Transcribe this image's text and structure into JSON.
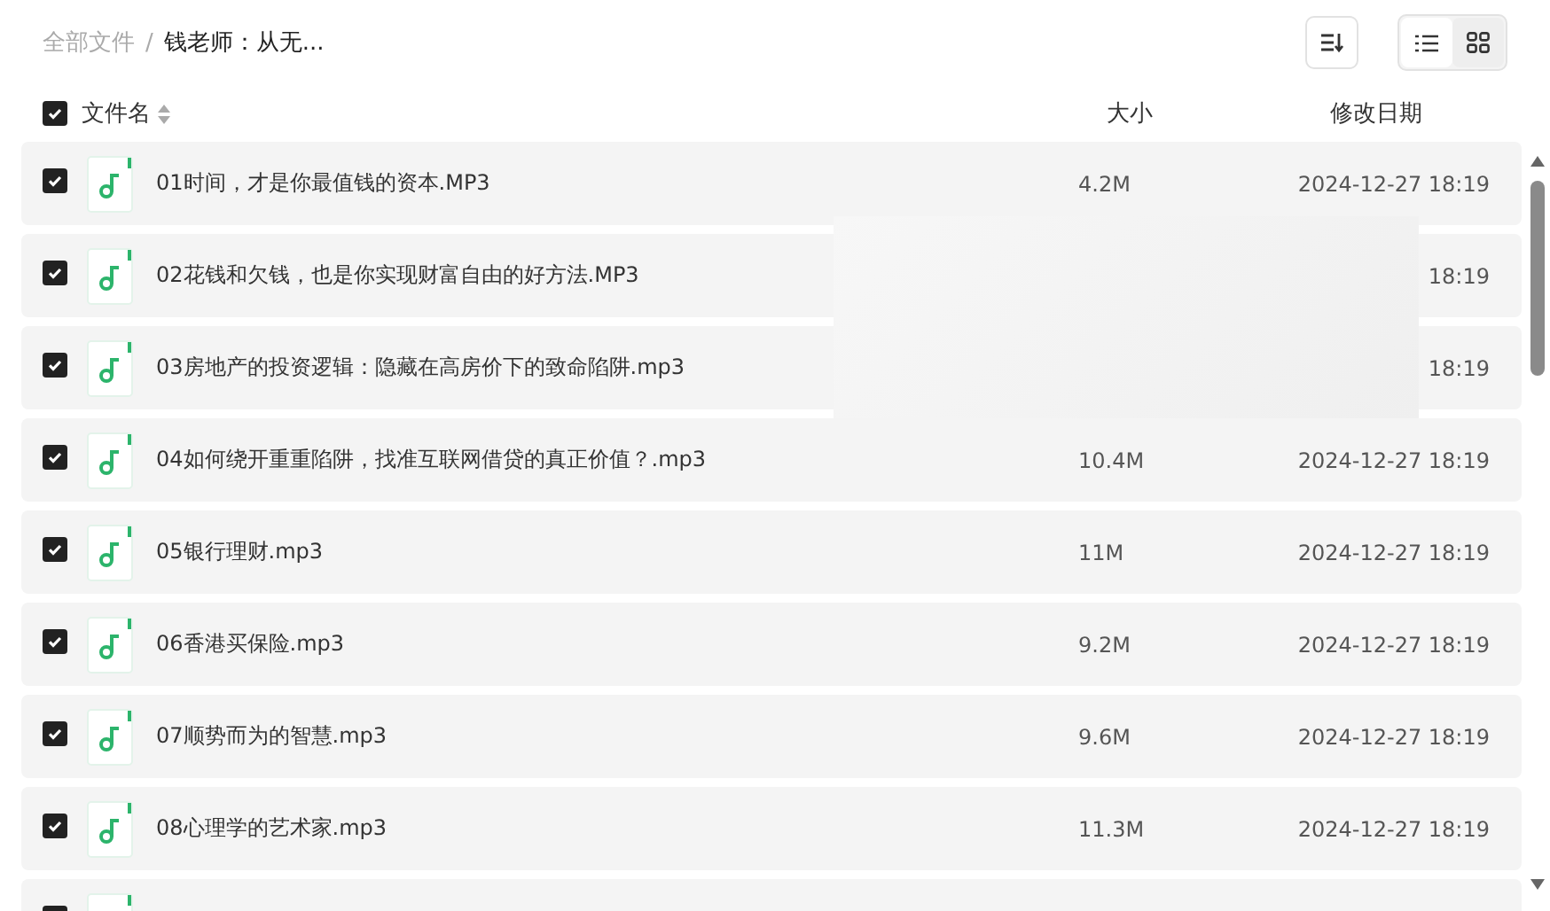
{
  "breadcrumb": [
    {
      "label": "全部文件",
      "current": false
    },
    {
      "label": "/",
      "current": false
    },
    {
      "label": "钱老师：从无...",
      "current": true
    }
  ],
  "toolbar": {
    "views": [
      {
        "kind": "list",
        "selected": true
      },
      {
        "kind": "grid",
        "selected": false
      }
    ]
  },
  "header": {
    "checked": true,
    "name": "文件名",
    "size": "大小",
    "date": "修改日期"
  },
  "files": [
    {
      "checked": true,
      "name": "01时间，才是你最值钱的资本.MP3",
      "size": "4.2M",
      "date": "2024-12-27 18:19"
    },
    {
      "checked": true,
      "name": "02花钱和欠钱，也是你实现财富自由的好方法.MP3",
      "date": "18:19"
    },
    {
      "checked": true,
      "name": "03房地产的投资逻辑：隐藏在高房价下的致命陷阱.mp3",
      "date": "18:19"
    },
    {
      "checked": true,
      "name": "04如何绕开重重陷阱，找准互联网借贷的真正价值？.mp3",
      "size": "10.4M",
      "date": "2024-12-27 18:19"
    },
    {
      "checked": true,
      "name": "05银行理财.mp3",
      "size": "11M",
      "date": "2024-12-27 18:19"
    },
    {
      "checked": true,
      "name": "06香港买保险.mp3",
      "size": "9.2M",
      "date": "2024-12-27 18:19"
    },
    {
      "checked": true,
      "name": "07顺势而为的智慧.mp3",
      "size": "9.6M",
      "date": "2024-12-27 18:19"
    },
    {
      "checked": true,
      "name": "08心理学的艺术家.mp3",
      "size": "11.3M",
      "date": "2024-12-27 18:19"
    },
    {
      "checked": true
    }
  ]
}
